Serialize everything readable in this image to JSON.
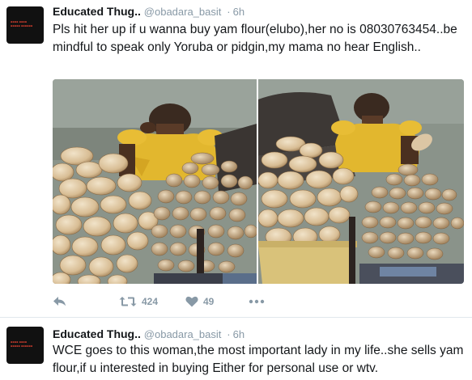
{
  "tweets": [
    {
      "name": "Educated Thug..",
      "handle": "@obadara_basit",
      "separator": "·",
      "time": "6h",
      "text": "Pls hit her up if u wanna buy yam flour(elubo),her no is 08030763454..be mindful to speak only Yoruba or pidgin,my mama no hear English..",
      "retweets": "424",
      "likes": "49"
    },
    {
      "name": "Educated Thug..",
      "handle": "@obadara_basit",
      "separator": "·",
      "time": "6h",
      "text": "WCE goes to this woman,the most important lady in my life..she sells yam flour,if u interested in buying Either for personal use or wtv."
    }
  ],
  "icons": {
    "reply": "reply-icon",
    "retweet": "retweet-icon",
    "like": "heart-icon",
    "more": "more-icon"
  },
  "colors": {
    "name": "#14171a",
    "meta": "#8899a6",
    "divider": "#e1e8ed"
  }
}
